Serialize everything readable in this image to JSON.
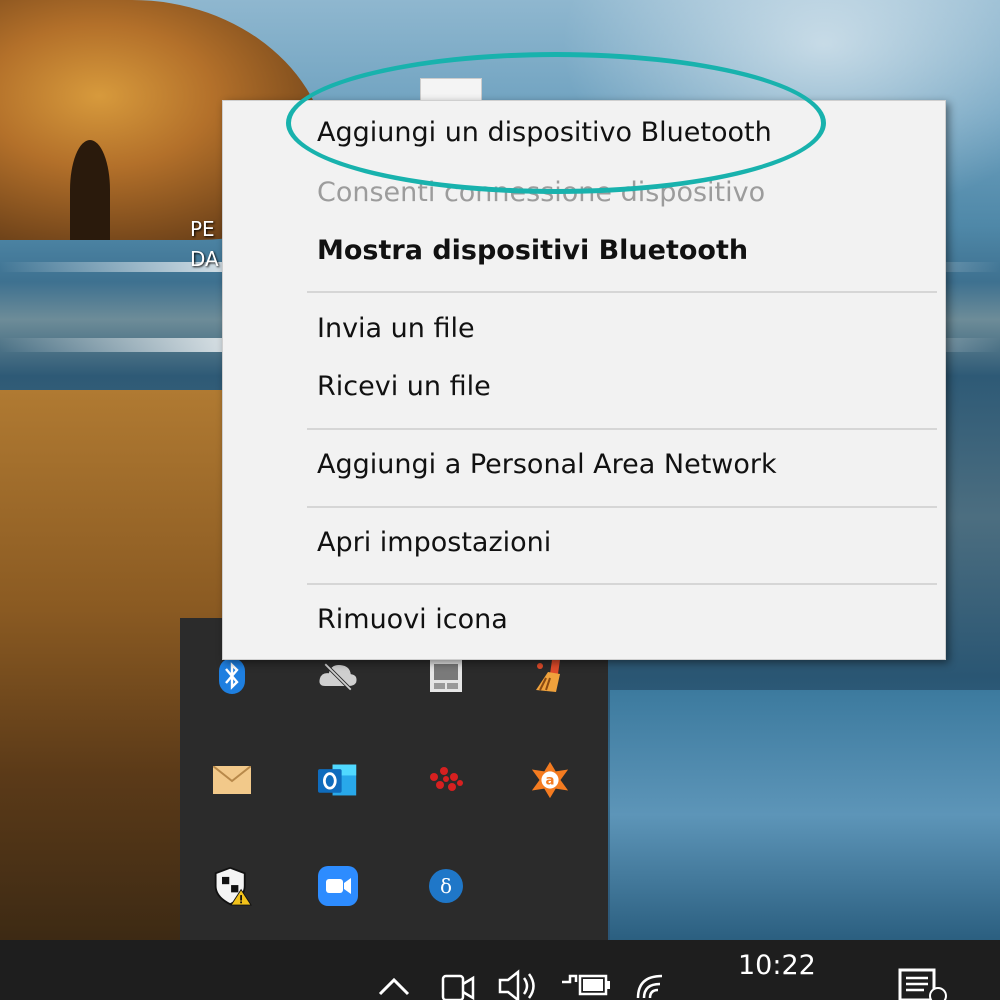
{
  "desktop": {
    "icon_label_line1": "PE",
    "icon_label_line2": "DA"
  },
  "context_menu": {
    "items": [
      {
        "label": "Aggiungi un dispositivo Bluetooth",
        "state": "normal"
      },
      {
        "label": "Consenti connessione dispositivo",
        "state": "disabled"
      },
      {
        "label": "Mostra dispositivi Bluetooth",
        "state": "default"
      },
      {
        "label": "Invia un file",
        "state": "normal"
      },
      {
        "label": "Ricevi un file",
        "state": "normal"
      },
      {
        "label": "Aggiungi a Personal Area Network",
        "state": "normal"
      },
      {
        "label": "Apri impostazioni",
        "state": "normal"
      },
      {
        "label": "Rimuovi icona",
        "state": "normal"
      }
    ]
  },
  "highlight": {
    "color": "#18b2ad"
  },
  "tray_icons": [
    {
      "name": "bluetooth-icon"
    },
    {
      "name": "cloud-offline-icon"
    },
    {
      "name": "tablet-icon"
    },
    {
      "name": "cleaner-icon"
    },
    {
      "name": "mail-icon"
    },
    {
      "name": "outlook-icon"
    },
    {
      "name": "red-dots-icon"
    },
    {
      "name": "avast-icon"
    },
    {
      "name": "security-warning-icon"
    },
    {
      "name": "zoom-icon"
    },
    {
      "name": "delta-icon"
    }
  ],
  "taskbar": {
    "clock": "10:22"
  },
  "colors": {
    "menu_bg": "#f2f2f2",
    "tray_bg": "#2b2b2b",
    "taskbar_bg": "#1e1e1e",
    "bluetooth": "#1e7fe0",
    "outlook": "#0f6cbd",
    "zoom": "#2d8cff",
    "avast": "#f47b20"
  }
}
